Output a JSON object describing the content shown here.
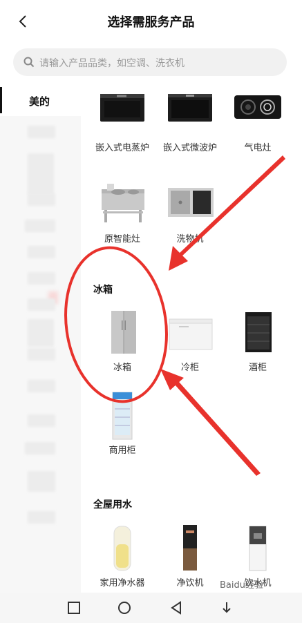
{
  "header": {
    "title": "选择需服务产品"
  },
  "search": {
    "placeholder": "请输入产品品类，如空调、洗衣机"
  },
  "sidebar": {
    "active_label": "美的"
  },
  "sections": [
    {
      "title": "",
      "items": [
        {
          "label": "嵌入式电蒸炉"
        },
        {
          "label": "嵌入式微波炉"
        },
        {
          "label": "气电灶"
        },
        {
          "label": "原智能灶"
        },
        {
          "label": "洗物机"
        }
      ]
    },
    {
      "title": "冰箱",
      "items": [
        {
          "label": "冰箱"
        },
        {
          "label": "冷柜"
        },
        {
          "label": "酒柜"
        },
        {
          "label": "商用柜"
        }
      ]
    },
    {
      "title": "全屋用水",
      "items": [
        {
          "label": "家用净水器"
        },
        {
          "label": "净饮机"
        },
        {
          "label": "饮水机"
        }
      ]
    }
  ],
  "annotation": {
    "color": "#e8322c"
  },
  "watermark": "Baidu经验"
}
